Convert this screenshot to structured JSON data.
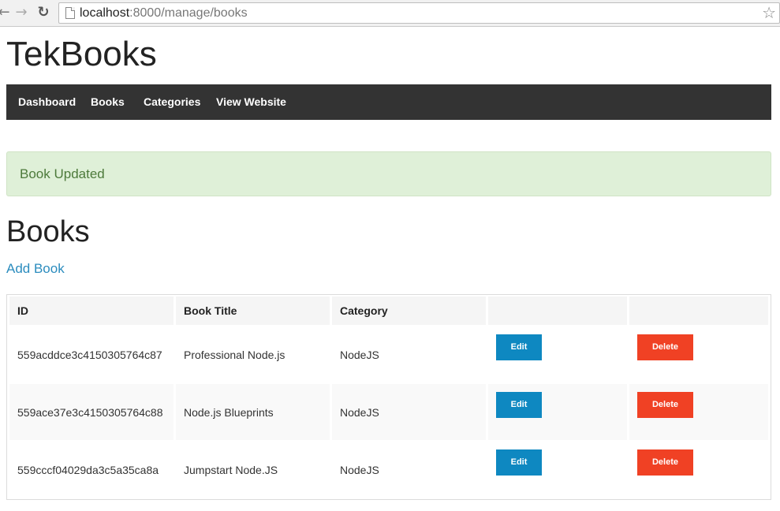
{
  "browser": {
    "url_host": "localhost",
    "url_rest": ":8000/manage/books",
    "back_glyph": "←",
    "forward_glyph": "→",
    "reload_glyph": "↻",
    "star_glyph": "☆"
  },
  "site": {
    "brand": "TekBooks"
  },
  "navbar": {
    "items": [
      {
        "label": "Dashboard"
      },
      {
        "label": "Books"
      },
      {
        "label": "Categories"
      },
      {
        "label": "View Website"
      }
    ]
  },
  "alert": {
    "message": "Book Updated"
  },
  "page": {
    "heading": "Books",
    "add_link": "Add Book"
  },
  "table": {
    "headers": [
      "ID",
      "Book Title",
      "Category",
      "",
      ""
    ],
    "rows": [
      {
        "id": "559acddce3c4150305764c87",
        "title": "Professional Node.js",
        "category": "NodeJS",
        "edit": "Edit",
        "delete": "Delete"
      },
      {
        "id": "559ace37e3c4150305764c88",
        "title": "Node.js Blueprints",
        "category": "NodeJS",
        "edit": "Edit",
        "delete": "Delete"
      },
      {
        "id": "559cccf04029da3c5a35ca8a",
        "title": "Jumpstart Node.JS",
        "category": "NodeJS",
        "edit": "Edit",
        "delete": "Delete"
      }
    ]
  },
  "colors": {
    "navbar_bg": "#333333",
    "alert_bg": "#dff0d8",
    "link": "#2b8cbe",
    "edit_button": "#0e88c1",
    "delete_button": "#f04124"
  }
}
